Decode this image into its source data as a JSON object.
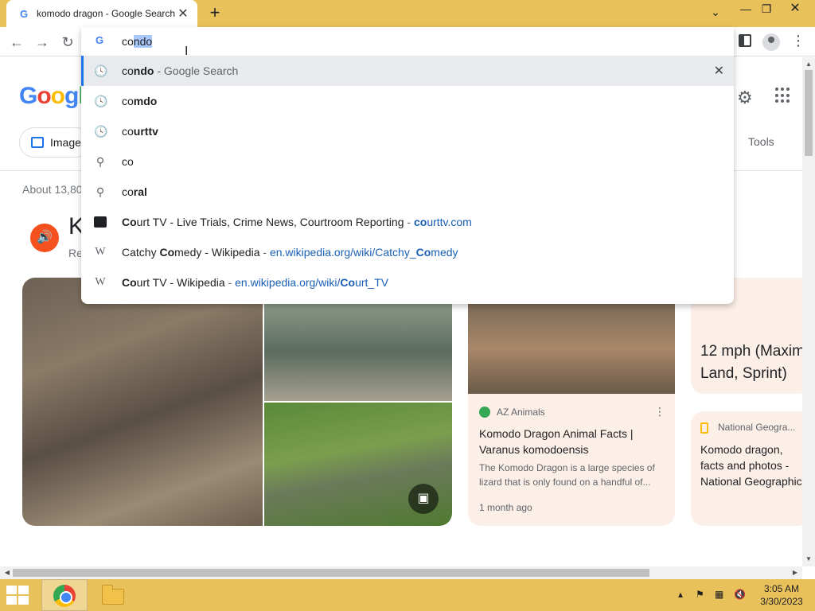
{
  "browser": {
    "tab_title": "komodo dragon - Google Search",
    "tab_favicon": "G",
    "tab_close": "✕",
    "new_tab": "+",
    "window_controls": {
      "dropdown": "⌄",
      "minimize": "—",
      "maximize": "❐",
      "close": "✕"
    }
  },
  "toolbar": {
    "back": "←",
    "forward": "→",
    "reload": "↻",
    "menu": "⋮"
  },
  "omnibox": {
    "typed": "co",
    "autocomplete": "ndo",
    "suggestions": [
      {
        "icon": "history-icon",
        "bold_pre": "co",
        "bold": "ndo",
        "suffix": " - Google Search",
        "removable": true
      },
      {
        "icon": "history-icon",
        "pre": "co",
        "bold": "mdo"
      },
      {
        "icon": "history-icon",
        "pre": "co",
        "bold": "urttv"
      },
      {
        "icon": "search-icon",
        "pre": "co",
        "bold": ""
      },
      {
        "icon": "search-icon",
        "pre": "co",
        "bold": "ral"
      },
      {
        "icon": "courttv-icon",
        "title_bold": "Co",
        "title_rest": "urt TV - Live Trials, Crime News, Courtroom Reporting",
        "sep": " - ",
        "url_bold": "co",
        "url_rest": "urttv.com"
      },
      {
        "icon": "wikipedia-icon",
        "title_pre": "Catchy ",
        "title_bold": "Co",
        "title_rest": "medy - Wikipedia",
        "sep": " - ",
        "url_pre": "en.wikipedia.org/wiki/Catchy_",
        "url_bold": "Co",
        "url_rest": "medy"
      },
      {
        "icon": "wikipedia-icon",
        "title_bold": "Co",
        "title_rest": "urt TV - Wikipedia",
        "sep": " - ",
        "url_pre": "en.wikipedia.org/wiki/",
        "url_bold": "Co",
        "url_rest": "urt_TV"
      }
    ],
    "remove_label": "✕"
  },
  "page": {
    "logo_letters": [
      "G",
      "o",
      "o",
      "g",
      "l"
    ],
    "images_chip": "Images",
    "tools": "Tools",
    "results_count": "About 13,80",
    "kp_title_initial": "K",
    "kp_sub": "Re",
    "big_fact_line1": "12 mph (Maxim",
    "big_fact_line2": "Land, Sprint)",
    "card1": {
      "source": "AZ Animals",
      "title_line1": "Komodo Dragon Animal Facts |",
      "title_line2": "Varanus komodoensis",
      "desc_line1": "The Komodo Dragon is a large species of",
      "desc_line2": "lizard that is only found on a handful of...",
      "date": "1 month ago"
    },
    "card3": {
      "source": "National Geogra...",
      "title_line1": "Komodo dragon,",
      "title_line2": "facts and photos -",
      "title_line3": "National Geographic"
    }
  },
  "taskbar": {
    "time": "3:05 AM",
    "date": "3/30/2023"
  },
  "colors": {
    "titlebar": "#e8c15a",
    "accent": "#1a73e8",
    "card_bg": "#fcefe8"
  }
}
